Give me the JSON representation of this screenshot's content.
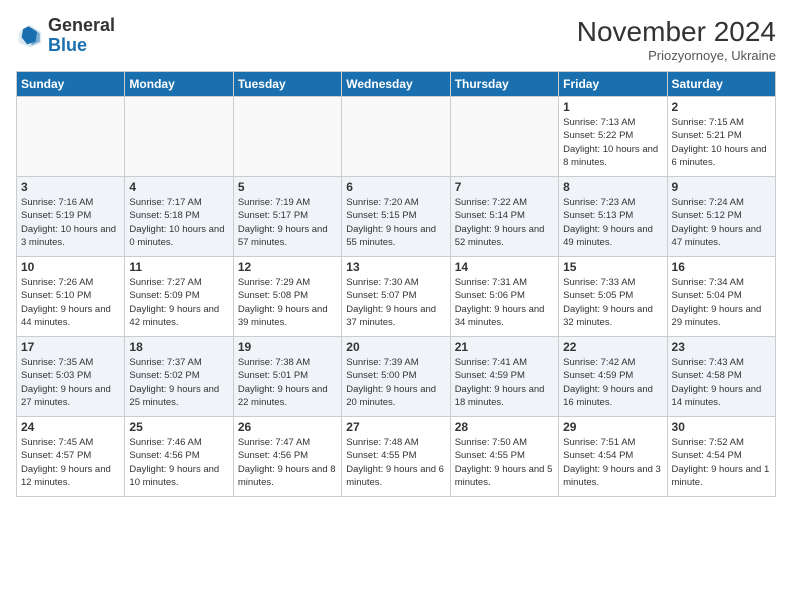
{
  "logo": {
    "text_general": "General",
    "text_blue": "Blue"
  },
  "header": {
    "month": "November 2024",
    "location": "Priozyornoye, Ukraine"
  },
  "weekdays": [
    "Sunday",
    "Monday",
    "Tuesday",
    "Wednesday",
    "Thursday",
    "Friday",
    "Saturday"
  ],
  "weeks": [
    [
      {
        "day": "",
        "info": ""
      },
      {
        "day": "",
        "info": ""
      },
      {
        "day": "",
        "info": ""
      },
      {
        "day": "",
        "info": ""
      },
      {
        "day": "",
        "info": ""
      },
      {
        "day": "1",
        "info": "Sunrise: 7:13 AM\nSunset: 5:22 PM\nDaylight: 10 hours and 8 minutes."
      },
      {
        "day": "2",
        "info": "Sunrise: 7:15 AM\nSunset: 5:21 PM\nDaylight: 10 hours and 6 minutes."
      }
    ],
    [
      {
        "day": "3",
        "info": "Sunrise: 7:16 AM\nSunset: 5:19 PM\nDaylight: 10 hours and 3 minutes."
      },
      {
        "day": "4",
        "info": "Sunrise: 7:17 AM\nSunset: 5:18 PM\nDaylight: 10 hours and 0 minutes."
      },
      {
        "day": "5",
        "info": "Sunrise: 7:19 AM\nSunset: 5:17 PM\nDaylight: 9 hours and 57 minutes."
      },
      {
        "day": "6",
        "info": "Sunrise: 7:20 AM\nSunset: 5:15 PM\nDaylight: 9 hours and 55 minutes."
      },
      {
        "day": "7",
        "info": "Sunrise: 7:22 AM\nSunset: 5:14 PM\nDaylight: 9 hours and 52 minutes."
      },
      {
        "day": "8",
        "info": "Sunrise: 7:23 AM\nSunset: 5:13 PM\nDaylight: 9 hours and 49 minutes."
      },
      {
        "day": "9",
        "info": "Sunrise: 7:24 AM\nSunset: 5:12 PM\nDaylight: 9 hours and 47 minutes."
      }
    ],
    [
      {
        "day": "10",
        "info": "Sunrise: 7:26 AM\nSunset: 5:10 PM\nDaylight: 9 hours and 44 minutes."
      },
      {
        "day": "11",
        "info": "Sunrise: 7:27 AM\nSunset: 5:09 PM\nDaylight: 9 hours and 42 minutes."
      },
      {
        "day": "12",
        "info": "Sunrise: 7:29 AM\nSunset: 5:08 PM\nDaylight: 9 hours and 39 minutes."
      },
      {
        "day": "13",
        "info": "Sunrise: 7:30 AM\nSunset: 5:07 PM\nDaylight: 9 hours and 37 minutes."
      },
      {
        "day": "14",
        "info": "Sunrise: 7:31 AM\nSunset: 5:06 PM\nDaylight: 9 hours and 34 minutes."
      },
      {
        "day": "15",
        "info": "Sunrise: 7:33 AM\nSunset: 5:05 PM\nDaylight: 9 hours and 32 minutes."
      },
      {
        "day": "16",
        "info": "Sunrise: 7:34 AM\nSunset: 5:04 PM\nDaylight: 9 hours and 29 minutes."
      }
    ],
    [
      {
        "day": "17",
        "info": "Sunrise: 7:35 AM\nSunset: 5:03 PM\nDaylight: 9 hours and 27 minutes."
      },
      {
        "day": "18",
        "info": "Sunrise: 7:37 AM\nSunset: 5:02 PM\nDaylight: 9 hours and 25 minutes."
      },
      {
        "day": "19",
        "info": "Sunrise: 7:38 AM\nSunset: 5:01 PM\nDaylight: 9 hours and 22 minutes."
      },
      {
        "day": "20",
        "info": "Sunrise: 7:39 AM\nSunset: 5:00 PM\nDaylight: 9 hours and 20 minutes."
      },
      {
        "day": "21",
        "info": "Sunrise: 7:41 AM\nSunset: 4:59 PM\nDaylight: 9 hours and 18 minutes."
      },
      {
        "day": "22",
        "info": "Sunrise: 7:42 AM\nSunset: 4:59 PM\nDaylight: 9 hours and 16 minutes."
      },
      {
        "day": "23",
        "info": "Sunrise: 7:43 AM\nSunset: 4:58 PM\nDaylight: 9 hours and 14 minutes."
      }
    ],
    [
      {
        "day": "24",
        "info": "Sunrise: 7:45 AM\nSunset: 4:57 PM\nDaylight: 9 hours and 12 minutes."
      },
      {
        "day": "25",
        "info": "Sunrise: 7:46 AM\nSunset: 4:56 PM\nDaylight: 9 hours and 10 minutes."
      },
      {
        "day": "26",
        "info": "Sunrise: 7:47 AM\nSunset: 4:56 PM\nDaylight: 9 hours and 8 minutes."
      },
      {
        "day": "27",
        "info": "Sunrise: 7:48 AM\nSunset: 4:55 PM\nDaylight: 9 hours and 6 minutes."
      },
      {
        "day": "28",
        "info": "Sunrise: 7:50 AM\nSunset: 4:55 PM\nDaylight: 9 hours and 5 minutes."
      },
      {
        "day": "29",
        "info": "Sunrise: 7:51 AM\nSunset: 4:54 PM\nDaylight: 9 hours and 3 minutes."
      },
      {
        "day": "30",
        "info": "Sunrise: 7:52 AM\nSunset: 4:54 PM\nDaylight: 9 hours and 1 minute."
      }
    ]
  ]
}
